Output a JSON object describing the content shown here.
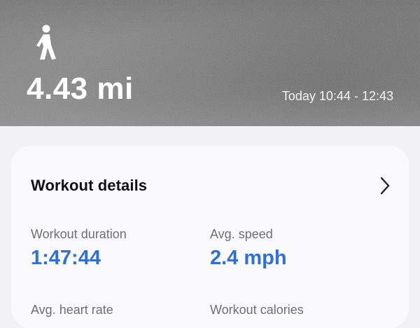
{
  "hero": {
    "activity_icon": "walking-person-icon",
    "distance": "4.43 mi",
    "time_range": "Today 10:44 - 12:43"
  },
  "details": {
    "title": "Workout details",
    "chevron_icon": "chevron-right-icon",
    "metrics": [
      {
        "label": "Workout duration",
        "value": "1:47:44"
      },
      {
        "label": "Avg. speed",
        "value": "2.4 mph"
      },
      {
        "label": "Avg. heart rate",
        "value": ""
      },
      {
        "label": "Workout calories",
        "value": ""
      }
    ]
  },
  "colors": {
    "accent": "#2f6fd6",
    "card_bg": "#fafafc",
    "page_bg": "#f2f2f4"
  }
}
